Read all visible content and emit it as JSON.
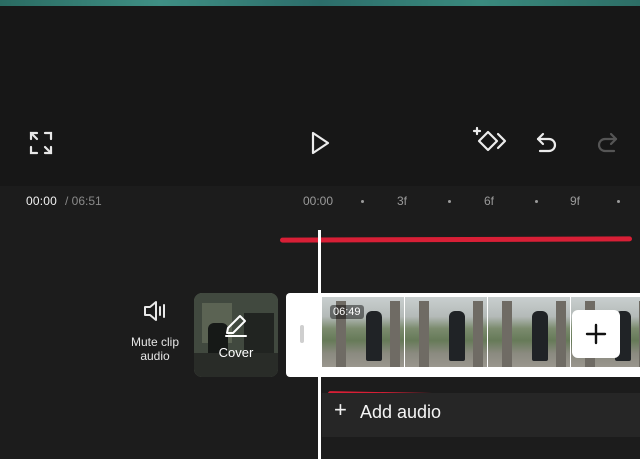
{
  "toolbar": {
    "fullscreen_icon": "fullscreen-icon",
    "play_icon": "play-icon",
    "keyframe_icon": "keyframe-add-icon",
    "undo_icon": "undo-icon",
    "redo_icon": "redo-icon"
  },
  "timecode": {
    "current": "00:00",
    "total": "/ 06:51"
  },
  "ruler": {
    "labels": [
      "00:00",
      "3f",
      "6f",
      "9f"
    ]
  },
  "track": {
    "mute_label": "Mute clip audio",
    "cover_label": "Cover",
    "clip_duration": "06:49",
    "add_clip_icon": "plus-icon"
  },
  "audio": {
    "add_label": "Add audio",
    "add_icon": "+"
  },
  "colors": {
    "background": "#161616",
    "timeline": "#1c1c1c",
    "annotation_red": "#d81f36"
  }
}
